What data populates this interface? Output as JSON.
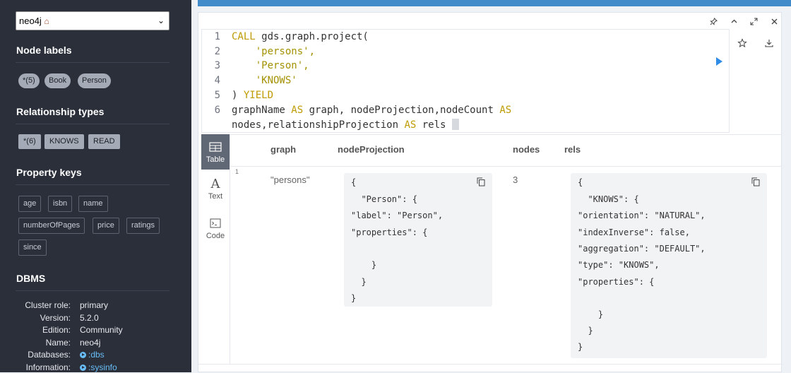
{
  "sidebar": {
    "database": "neo4j",
    "database_icon": "house-icon",
    "node_labels_title": "Node labels",
    "node_labels": [
      "*(5)",
      "Book",
      "Person"
    ],
    "rel_types_title": "Relationship types",
    "rel_types": [
      "*(6)",
      "KNOWS",
      "READ"
    ],
    "prop_keys_title": "Property keys",
    "prop_keys": [
      "age",
      "isbn",
      "name",
      "numberOfPages",
      "price",
      "ratings",
      "since"
    ],
    "dbms_title": "DBMS",
    "dbms": [
      {
        "key": "Cluster role:",
        "value": "primary"
      },
      {
        "key": "Version:",
        "value": "5.2.0"
      },
      {
        "key": "Edition:",
        "value": "Community"
      },
      {
        "key": "Name:",
        "value": "neo4j"
      },
      {
        "key": "Databases:",
        "value": ":dbs"
      },
      {
        "key": "Information:",
        "value": ":sysinfo"
      }
    ]
  },
  "editor": {
    "line_numbers": [
      "1",
      "2",
      "3",
      "4",
      "5",
      "6"
    ],
    "lines": {
      "l1_kw": "CALL",
      "l1_rest": " gds.graph.project(",
      "l2": "    'persons',",
      "l3": "    'Person',",
      "l4": "    'KNOWS'",
      "l5_a": ") ",
      "l5_kw": "YIELD",
      "l6_a": "graphName ",
      "l6_as1": "AS",
      "l6_b": " graph, nodeProjection,nodeCount ",
      "l6_as2": "AS",
      "l7_a": "nodes,relationshipProjection ",
      "l7_as": "AS",
      "l7_b": " rels "
    }
  },
  "views": {
    "table": "Table",
    "text": "Text",
    "code": "Code"
  },
  "table": {
    "headers": [
      "graph",
      "nodeProjection",
      "nodes",
      "rels"
    ],
    "row_number": "1",
    "graph": "\"persons\"",
    "nodes": "3",
    "node_projection": [
      "{",
      "  \"Person\": {",
      "\"label\": \"Person\",",
      "\"properties\": {",
      "",
      "    }",
      "  }",
      "}"
    ],
    "rels": [
      "{",
      "  \"KNOWS\": {",
      "\"orientation\": \"NATURAL\",",
      "\"indexInverse\": false,",
      "\"aggregation\": \"DEFAULT\",",
      "\"type\": \"KNOWS\",",
      "\"properties\": {",
      "",
      "    }",
      "  }",
      "}"
    ]
  },
  "colors": {
    "sidebar_bg": "#2a2f3a",
    "accent": "#428bca",
    "link": "#68bdf6",
    "keyword": "#bd9b00"
  }
}
